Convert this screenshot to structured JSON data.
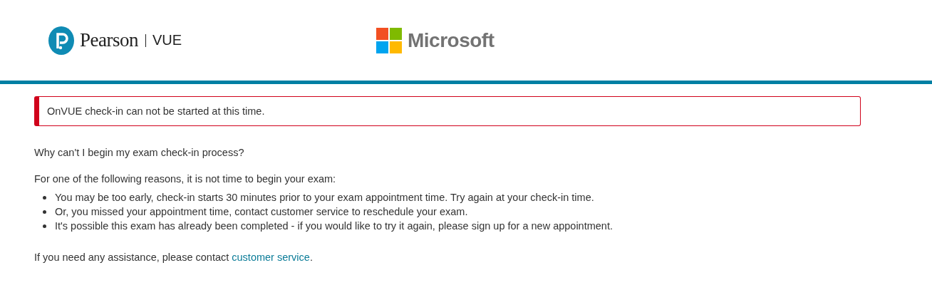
{
  "header": {
    "pearson_name": "Pearson",
    "pearson_product": "VUE",
    "microsoft_name": "Microsoft"
  },
  "alert": {
    "message": "OnVUE check-in can not be started at this time."
  },
  "question": "Why can't I begin my exam check-in process?",
  "intro": "For one of the following reasons, it is not time to begin your exam:",
  "reasons": [
    "You may be too early, check-in starts 30 minutes prior to your exam appointment time. Try again at your check-in time.",
    "Or, you missed your appointment time, contact customer service to reschedule your exam.",
    "It's possible this exam has already been completed - if you would like to try it again, please sign up for a new appointment."
  ],
  "help": {
    "text": "If you need any assistance, please contact ",
    "link": "customer service",
    "after": "."
  }
}
